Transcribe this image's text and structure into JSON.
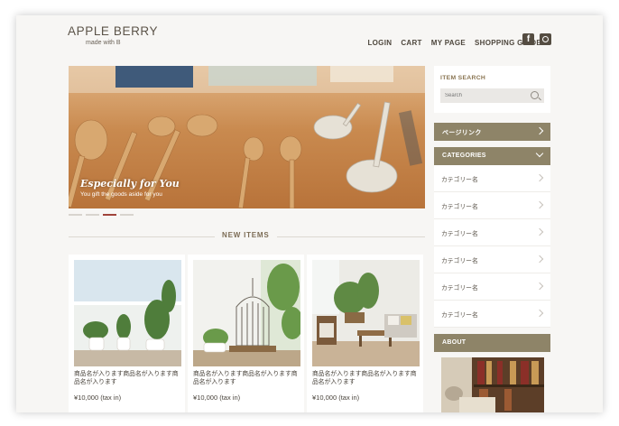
{
  "header": {
    "logo_title": "APPLE BERRY",
    "logo_sub": "made with B",
    "nav": [
      "LOGIN",
      "CART",
      "MY PAGE",
      "SHOPPING GUIDE"
    ],
    "social": [
      {
        "icon": "facebook-icon",
        "glyph": "f"
      },
      {
        "icon": "instagram-icon"
      }
    ]
  },
  "hero": {
    "title": "Especially for You",
    "subtitle": "You gift the goods aside for you",
    "slides": 4,
    "active_slide": 3
  },
  "new_items": {
    "title": "NEW ITEMS",
    "products": [
      {
        "name": "商品名が入ります商品名が入ります商品名が入ります",
        "price": "¥10,000 (tax in)"
      },
      {
        "name": "商品名が入ります商品名が入ります商品名が入ります",
        "price": "¥10,000 (tax in)"
      },
      {
        "name": "商品名が入ります商品名が入ります商品名が入ります",
        "price": "¥10,000 (tax in)"
      }
    ]
  },
  "sidebar": {
    "search_label": "ITEM SEARCH",
    "search_placeholder": "Search",
    "page_link": "ページリンク",
    "categories_title": "CATEGORIES",
    "categories": [
      "カテゴリー名",
      "カテゴリー名",
      "カテゴリー名",
      "カテゴリー名",
      "カテゴリー名",
      "カテゴリー名"
    ],
    "about_title": "ABOUT"
  },
  "colors": {
    "accent_bar": "#8e8468",
    "active_dot": "#a0443a",
    "background": "#f7f6f4"
  }
}
